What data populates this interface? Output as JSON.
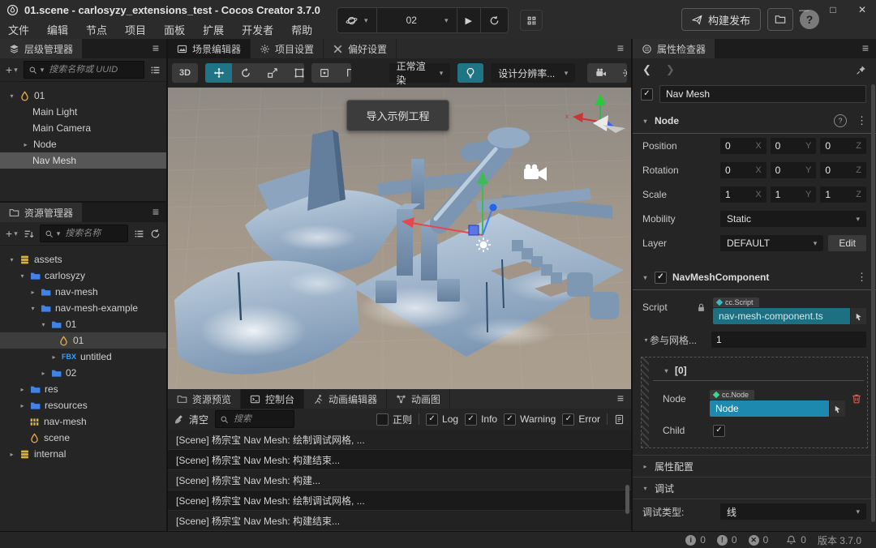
{
  "titlebar": {
    "title": "01.scene - carlosyzy_extensions_test - Cocos Creator 3.7.0",
    "menus": [
      "文件",
      "编辑",
      "节点",
      "项目",
      "面板",
      "扩展",
      "开发者",
      "帮助"
    ],
    "scene_select": "02",
    "build_label": "构建发布",
    "help_label": "?"
  },
  "hierarchy": {
    "tab": "层级管理器",
    "search_placeholder": "搜索名称或 UUID",
    "nodes": [
      {
        "label": "01"
      },
      {
        "label": "Main Light"
      },
      {
        "label": "Main Camera"
      },
      {
        "label": "Node"
      },
      {
        "label": "Nav Mesh"
      }
    ]
  },
  "assets": {
    "tab": "资源管理器",
    "search_placeholder": "搜索名称",
    "fbx_badge": "FBX",
    "nodes": [
      {
        "label": "assets"
      },
      {
        "label": "carlosyzy"
      },
      {
        "label": "nav-mesh"
      },
      {
        "label": "nav-mesh-example"
      },
      {
        "label": "01"
      },
      {
        "label": "01"
      },
      {
        "label": "untitled"
      },
      {
        "label": "02"
      },
      {
        "label": "res"
      },
      {
        "label": "resources"
      },
      {
        "label": "nav-mesh"
      },
      {
        "label": "scene"
      },
      {
        "label": "internal"
      }
    ]
  },
  "scene": {
    "tabs": [
      "场景编辑器",
      "项目设置",
      "偏好设置"
    ],
    "dimension_label": "3D",
    "render_mode": "正常渲染",
    "resolution": "设计分辨率...",
    "tooltip": "导入示例工程"
  },
  "console": {
    "tabs": [
      "资源预览",
      "控制台",
      "动画编辑器",
      "动画图"
    ],
    "clear_label": "清空",
    "search_placeholder": "搜索",
    "regex_label": "正则",
    "filters": [
      "Log",
      "Info",
      "Warning",
      "Error"
    ],
    "logs": [
      "[Scene] 杨宗宝 Nav Mesh: 绘制调试网格, ...",
      "[Scene] 杨宗宝 Nav Mesh: 构建结束...",
      "[Scene] 杨宗宝 Nav Mesh: 构建...",
      "[Scene] 杨宗宝 Nav Mesh: 绘制调试网格, ...",
      "[Scene] 杨宗宝 Nav Mesh: 构建结束..."
    ]
  },
  "inspector": {
    "tab": "属性检查器",
    "node_name": "Nav Mesh",
    "node_section": "Node",
    "axes": [
      "X",
      "Y",
      "Z"
    ],
    "position": {
      "label": "Position",
      "values": [
        "0",
        "0",
        "0"
      ]
    },
    "rotation": {
      "label": "Rotation",
      "values": [
        "0",
        "0",
        "0"
      ]
    },
    "scale": {
      "label": "Scale",
      "values": [
        "1",
        "1",
        "1"
      ]
    },
    "mobility": {
      "label": "Mobility",
      "value": "Static"
    },
    "layer": {
      "label": "Layer",
      "value": "DEFAULT",
      "edit_label": "Edit"
    },
    "component": {
      "name": "NavMeshComponent",
      "script_label": "Script",
      "script_type": "cc.Script",
      "script_value": "nav-mesh-component.ts",
      "array_label": "参与网格...",
      "array_value": "1",
      "element_index": "[0]",
      "node_label": "Node",
      "node_type": "cc.Node",
      "node_value": "Node",
      "child_label": "Child"
    },
    "prop_config_label": "属性配置",
    "debug_label": "调试",
    "debug_type_label": "调试类型:",
    "debug_type_value": "线"
  },
  "statusbar": {
    "info_count": "0",
    "warning_count": "0",
    "error_count": "0",
    "bell_count": "0",
    "version": "版本 3.7.0"
  },
  "colors": {
    "accent_teal": "#1f7585",
    "folder_blue": "#3f83e8",
    "scene_orange": "#e8a33d",
    "script_field_teal": "#1c7082",
    "node_field_blue": "#1e89ae"
  }
}
